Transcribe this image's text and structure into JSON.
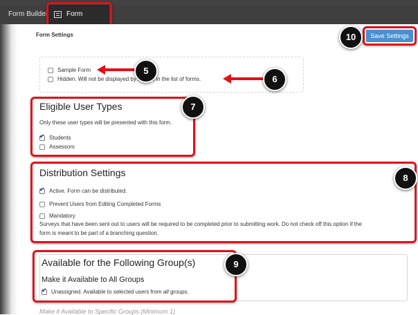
{
  "tabs": {
    "form_builder": "Form Builder",
    "form_settings": "Form Settings"
  },
  "header": {
    "title": "Form Settings",
    "save_label": "Save Settings"
  },
  "general": {
    "sample_label": "Sample Form",
    "hidden_label": "Hidden. Will not be displayed by default in the list of forms."
  },
  "eligible": {
    "title": "Eligible User Types",
    "description": "Only these user types will be presented with this form.",
    "students_label": "Students",
    "assessors_label": "Assessors"
  },
  "distribution": {
    "title": "Distribution Settings",
    "active_label": "Active. Form can be distributed.",
    "prevent_label": "Prevent Users from Editing Completed Forms",
    "mandatory_label": "Mandatory",
    "mandatory_desc_1": "Surveys that have been sent out to users will be required to be completed prior to submitting work. Do not check off this option if the",
    "mandatory_desc_2": "form is meant to be part of a branching question."
  },
  "groups": {
    "title": "Available for the Following Group(s)",
    "all_groups_heading": "Make it Available to All Groups",
    "unassigned_label_pre": "Unassigned. Available to selected users from ",
    "unassigned_label_em": "all",
    "unassigned_label_post": " groups.",
    "specific_heading": "Make it Available to Specific Groups (Minimum 1)"
  },
  "checkbox_states": {
    "sample": false,
    "hidden": false,
    "students": true,
    "assessors": false,
    "active": true,
    "prevent_editing": false,
    "mandatory": false,
    "unassigned": true
  },
  "callouts": {
    "c5": "5",
    "c6": "6",
    "c7": "7",
    "c8": "8",
    "c9": "9",
    "c10": "10"
  },
  "colors": {
    "highlight_red": "#e1101a",
    "button_blue": "#4a90d0",
    "tabbar_dark": "#3f3f3f"
  }
}
